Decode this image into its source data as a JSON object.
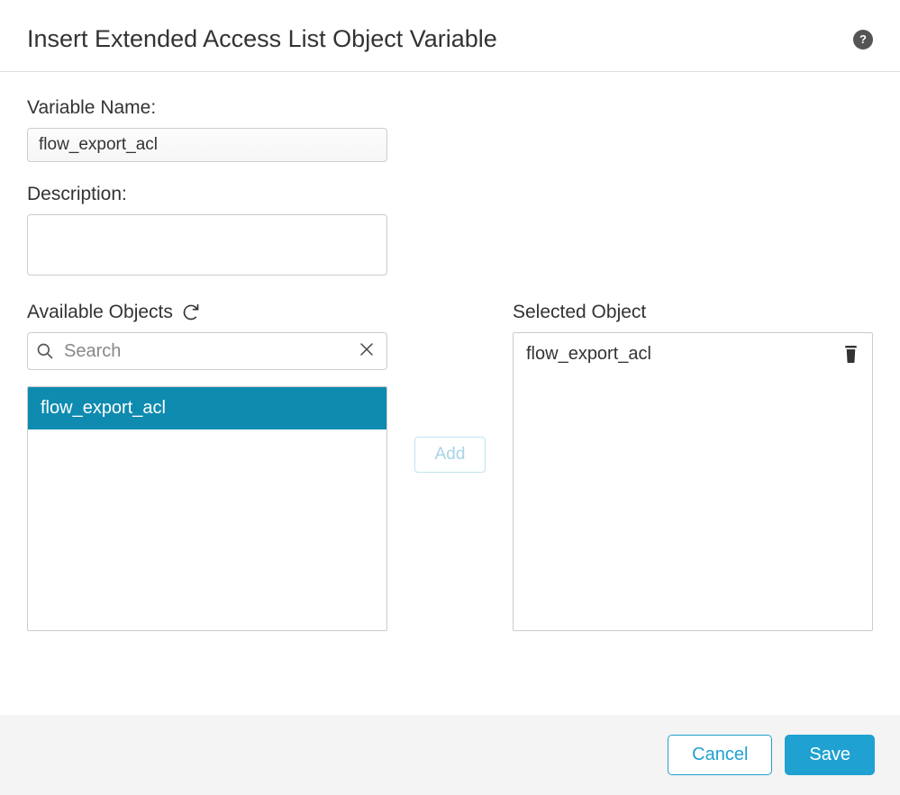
{
  "header": {
    "title": "Insert Extended Access List Object Variable"
  },
  "form": {
    "variable_name_label": "Variable Name:",
    "variable_name_value": "flow_export_acl",
    "description_label": "Description:",
    "description_value": ""
  },
  "available": {
    "title": "Available Objects",
    "search_placeholder": "Search",
    "search_value": "",
    "items": [
      "flow_export_acl"
    ]
  },
  "selected": {
    "title": "Selected Object",
    "items": [
      "flow_export_acl"
    ]
  },
  "buttons": {
    "add": "Add",
    "cancel": "Cancel",
    "save": "Save"
  }
}
